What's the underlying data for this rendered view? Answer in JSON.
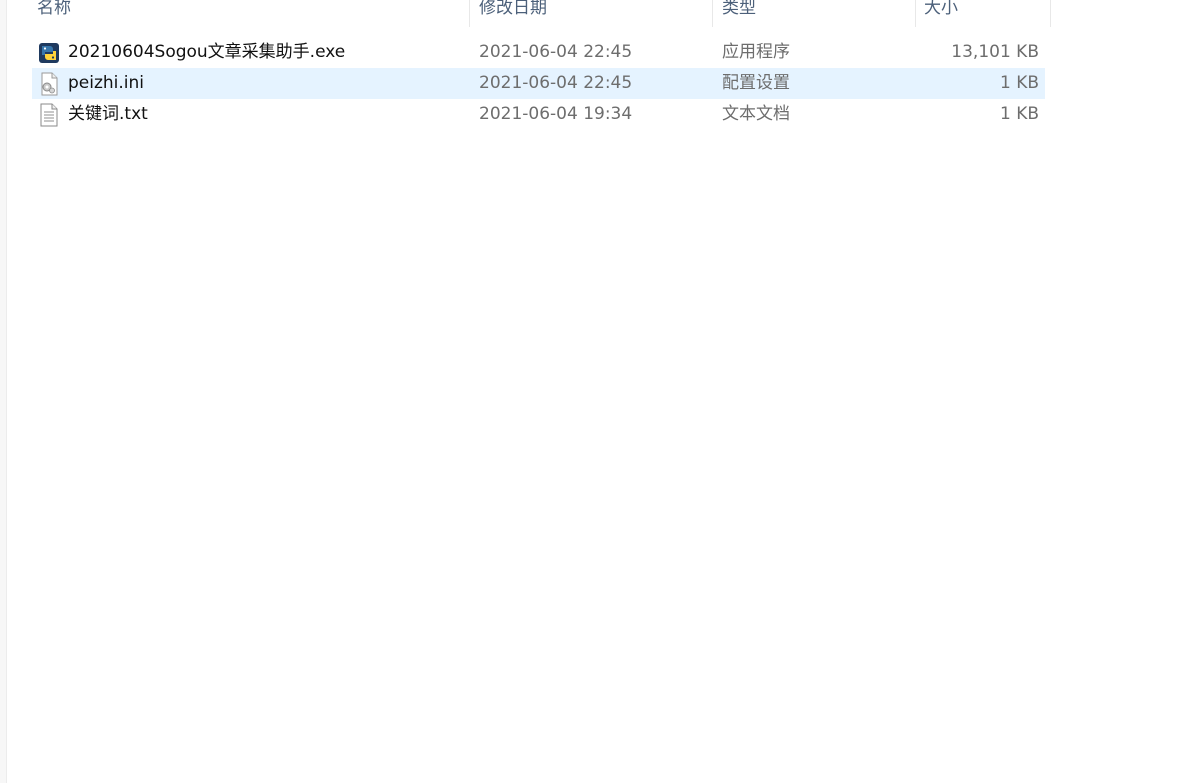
{
  "columns": {
    "name": "名称",
    "date": "修改日期",
    "type": "类型",
    "size": "大小"
  },
  "files": [
    {
      "name": "20210604Sogou文章采集助手.exe",
      "date": "2021-06-04 22:45",
      "type": "应用程序",
      "size": "13,101 KB",
      "icon": "python-exe-icon",
      "selected": false
    },
    {
      "name": "peizhi.ini",
      "date": "2021-06-04 22:45",
      "type": "配置设置",
      "size": "1 KB",
      "icon": "config-file-icon",
      "selected": true
    },
    {
      "name": "关键词.txt",
      "date": "2021-06-04 19:34",
      "type": "文本文档",
      "size": "1 KB",
      "icon": "text-file-icon",
      "selected": false
    }
  ],
  "colors": {
    "header_text": "#4c607a",
    "selection": "#e5f3ff",
    "secondary_text": "#6d6d6d"
  }
}
